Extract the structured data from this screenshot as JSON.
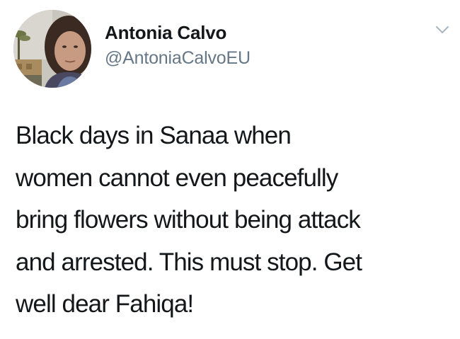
{
  "tweet": {
    "author": {
      "display_name": "Antonia Calvo",
      "handle": "@AntoniaCalvoEU"
    },
    "text_lines": [
      "Black days in Sanaa when",
      "women cannot even peacefully",
      "bring flowers without being attack",
      "and arrested. This must stop. Get",
      "well dear Fahiqa!"
    ],
    "icons": {
      "avatar": "profile-photo",
      "menu": "chevron-down-icon"
    },
    "colors": {
      "text": "#14171a",
      "handle": "#657786",
      "chevron": "#aab8c2"
    }
  }
}
